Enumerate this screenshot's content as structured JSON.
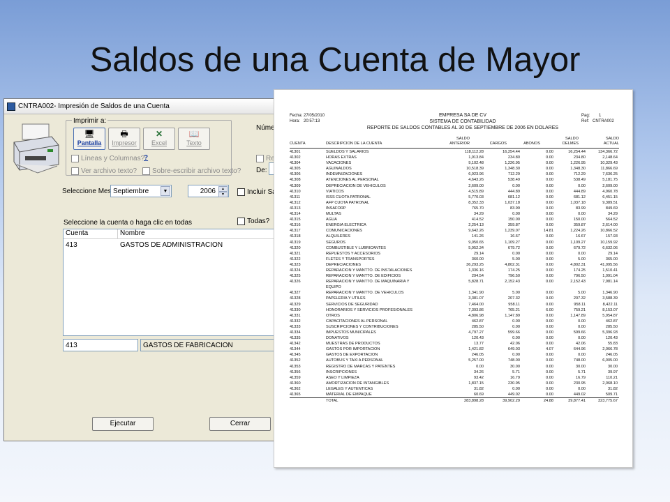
{
  "slide": {
    "title": "Saldos de una Cuenta de Mayor"
  },
  "dialog": {
    "title": "CNTRA002- Impresión de Saldos de una Cuenta",
    "print_group_label": "Imprimir a:",
    "buttons": [
      {
        "label": "Pantalla",
        "icon": "monitor-icon",
        "active": true
      },
      {
        "label": "Impresor",
        "icon": "printer-icon",
        "active": false
      },
      {
        "label": "Excel",
        "icon": "excel-icon",
        "active": false
      },
      {
        "label": "Texto",
        "icon": "book-icon",
        "active": false
      }
    ],
    "check_lineas": "Líneas y Columnas?",
    "help_mark": "?",
    "check_ver_archivo": "Ver archivo texto?",
    "check_sobreescribir": "Sobre-escribir archivo texto?",
    "numero_label": "Númer",
    "re_label": "Re",
    "de_label": "De:",
    "select_month_label": "Seleccione Mes",
    "month_value": "Septiembre",
    "year_value": "2006",
    "incluir_label": "Incluir Sa",
    "select_account_label": "Seleccione la cuenta o haga clic en todas",
    "todas_label": "Todas?",
    "list_columns": [
      "Cuenta",
      "Nombre"
    ],
    "list_rows": [
      {
        "cuenta": "413",
        "nombre": "GASTOS DE ADMINISTRACION"
      }
    ],
    "selected_account": "413",
    "selected_name": "GASTOS DE FABRICACION",
    "execute_label": "Ejecutar",
    "close_label": "Cerrar"
  },
  "report": {
    "fecha_label": "Fecha:",
    "fecha": "27/05/2010",
    "hora_label": "Hora:",
    "hora": "20:57:13",
    "company": "EMPRESA SA DE CV",
    "system": "SISTEMA DE CONTABILIDAD",
    "title": "REPORTE DE SALDOS CONTABLES AL 30 DE SEPTIEMBRE DE 2006 EN DOLARES",
    "pag_label": "Pag:",
    "pag": "1",
    "ref_label": "Ref:",
    "ref": "CNTRA002",
    "columns": {
      "cuenta": "CUENTA",
      "descripcion": "DESCRIPCION DE LA CUENTA",
      "saldo_anterior": "SALDO ANTERIOR",
      "cargos": "CARGOS",
      "abonos": "ABONOS",
      "saldo_delmes": "SALDO DELMES",
      "saldo_actual": "SALDO ACTUAL"
    },
    "rows": [
      [
        "41301",
        "SUELDOS Y SALARIOS",
        "118,112.28",
        "16,254.44",
        "0.00",
        "16,254.44",
        "134,366.72"
      ],
      [
        "41302",
        "HORAS EXTRAS",
        "1,913.84",
        "234.80",
        "0.00",
        "234.80",
        "2,148.64"
      ],
      [
        "41304",
        "VACACIONES",
        "9,102.48",
        "1,226.95",
        "0.00",
        "1,226.95",
        "10,329.43"
      ],
      [
        "41305",
        "AGUINALDOS",
        "10,518.39",
        "1,348.30",
        "0.00",
        "1,348.30",
        "11,866.69"
      ],
      [
        "41306",
        "INDEMNIZACIONES",
        "6,923.96",
        "712.29",
        "0.00",
        "712.29",
        "7,636.25"
      ],
      [
        "41308",
        "ATENCIONES AL PERSONAL",
        "4,643.26",
        "538.49",
        "0.00",
        "538.49",
        "5,181.75"
      ],
      [
        "41309",
        "DEPRECIACION DE VEHICULOS",
        "2,609.00",
        "0.00",
        "0.00",
        "0.00",
        "2,609.00"
      ],
      [
        "41310",
        "VIATICOS",
        "4,515.89",
        "444.89",
        "0.00",
        "444.89",
        "4,960.78"
      ],
      [
        "41311",
        "ISSS CUOTA PATRONAL",
        "5,770.03",
        "681.12",
        "0.00",
        "681.12",
        "6,451.15"
      ],
      [
        "41312",
        "AFP CUOTA PATRONAL",
        "8,352.33",
        "1,037.18",
        "0.00",
        "1,037.18",
        "9,389.51"
      ],
      [
        "41313",
        "INSAFORP",
        "765.70",
        "83.99",
        "0.00",
        "83.99",
        "849.69"
      ],
      [
        "41314",
        "MULTAS",
        "34.29",
        "0.00",
        "0.00",
        "0.00",
        "34.29"
      ],
      [
        "41315",
        "AGUA",
        "414.52",
        "150.00",
        "0.00",
        "150.00",
        "564.52"
      ],
      [
        "41316",
        "ENERGIA ELECTRICA",
        "2,254.13",
        "359.87",
        "0.00",
        "359.87",
        "2,614.00"
      ],
      [
        "41317",
        "COMUNICACIONES",
        "9,642.26",
        "1,239.07",
        "14.81",
        "1,224.26",
        "10,866.52"
      ],
      [
        "41318",
        "ALQUILERES",
        "141.26",
        "16.67",
        "0.00",
        "16.67",
        "157.93"
      ],
      [
        "41319",
        "SEGUROS",
        "9,050.65",
        "1,109.27",
        "0.00",
        "1,109.27",
        "10,159.92"
      ],
      [
        "41320",
        "COMBUSTIBLE Y LUBRICANTES",
        "5,952.34",
        "679.72",
        "0.00",
        "679.72",
        "6,632.06"
      ],
      [
        "41321",
        "REPUESTOS Y ACCESORIOS",
        "29.14",
        "0.00",
        "0.00",
        "0.00",
        "29.14"
      ],
      [
        "41322",
        "FLETES Y TRANSPORTES",
        "360.00",
        "5.00",
        "0.00",
        "5.00",
        "365.00"
      ],
      [
        "41323",
        "DEPRECIACIONES",
        "36,293.25",
        "4,802.31",
        "0.00",
        "4,802.31",
        "41,095.56"
      ],
      [
        "41324",
        "REPARACION Y MANTTO. DE INSTALACIONES",
        "1,336.16",
        "174.25",
        "0.00",
        "174.25",
        "1,510.41"
      ],
      [
        "41325",
        "REPARACION Y MANTTO. DE EDIFICIOS",
        "294.54",
        "796.50",
        "0.00",
        "796.50",
        "1,091.04"
      ],
      [
        "41326",
        "REPARACION Y MANTTO. DE MAQUINARIA Y",
        "5,828.71",
        "2,152.43",
        "0.00",
        "2,152.43",
        "7,981.14"
      ],
      [
        "",
        "EQUIPO",
        "",
        "",
        "",
        "",
        ""
      ],
      [
        "41327",
        "REPARACION Y MANTTO. DE VEHICULOS",
        "1,341.90",
        "5.00",
        "0.00",
        "5.00",
        "1,346.90"
      ],
      [
        "41328",
        "PAPELERIA Y UTILES",
        "3,381.07",
        "207.32",
        "0.00",
        "207.32",
        "3,588.39"
      ],
      [
        "41329",
        "SERVICIOS DE SEGURIDAD",
        "7,464.00",
        "958.11",
        "0.00",
        "958.11",
        "8,422.11"
      ],
      [
        "41330",
        "HONORARIOS Y SERVICIOS PROFESIONALES",
        "7,393.86",
        "765.21",
        "6.00",
        "759.21",
        "8,153.07"
      ],
      [
        "41331",
        "OTROS",
        "4,806.98",
        "1,147.89",
        "0.00",
        "1,147.89",
        "5,954.87"
      ],
      [
        "41332",
        "CAPACITACIONES AL PERSONAL",
        "462.87",
        "0.00",
        "0.00",
        "0.00",
        "462.87"
      ],
      [
        "41333",
        "SUSCRIPCIONES Y CONTRIBUCIONES",
        "285.50",
        "0.00",
        "0.00",
        "0.00",
        "285.50"
      ],
      [
        "41334",
        "IMPUESTOS MUNICIPALES",
        "4,797.27",
        "599.66",
        "0.00",
        "599.66",
        "5,396.93"
      ],
      [
        "41335",
        "DONATIVOS",
        "120.43",
        "0.00",
        "0.00",
        "0.00",
        "120.43"
      ],
      [
        "41342",
        "MUESTRAS DE PRODUCTOS",
        "13.77",
        "42.06",
        "0.00",
        "42.06",
        "55.83"
      ],
      [
        "41344",
        "GASTOS POR IMPORTACION",
        "1,421.82",
        "649.03",
        "4.07",
        "644.96",
        "2,066.78"
      ],
      [
        "41345",
        "GASTOS DE EXPORTACION",
        "246.05",
        "0.00",
        "0.00",
        "0.00",
        "246.05"
      ],
      [
        "41352",
        "AUTOBUS Y TAXI A PERSONAL",
        "5,257.00",
        "748.00",
        "0.00",
        "748.00",
        "6,005.00"
      ],
      [
        "41353",
        "REGISTRO DE MARCAS Y PATENTES",
        "0.00",
        "30.00",
        "0.00",
        "30.00",
        "30.00"
      ],
      [
        "41356",
        "INSCRIPCIONES",
        "34.26",
        "5.71",
        "0.00",
        "5.71",
        "39.97"
      ],
      [
        "41359",
        "ASEO Y LIMPIEZA",
        "93.42",
        "16.79",
        "0.00",
        "16.79",
        "110.21"
      ],
      [
        "41360",
        "AMORTIZACION DE INTANGIBLES",
        "1,837.15",
        "230.95",
        "0.00",
        "230.95",
        "2,068.10"
      ],
      [
        "41362",
        "LEGALES Y AUTENTICAS",
        "31.82",
        "0.00",
        "0.00",
        "0.00",
        "31.82"
      ],
      [
        "41365",
        "MATERIAL DE EMPAQUE",
        "60.69",
        "449.02",
        "0.00",
        "449.02",
        "509.71"
      ]
    ],
    "total": [
      "",
      "TOTAL",
      "283,898.28",
      "39,902.29",
      "24.88",
      "39,877.41",
      "323,775.67"
    ]
  }
}
